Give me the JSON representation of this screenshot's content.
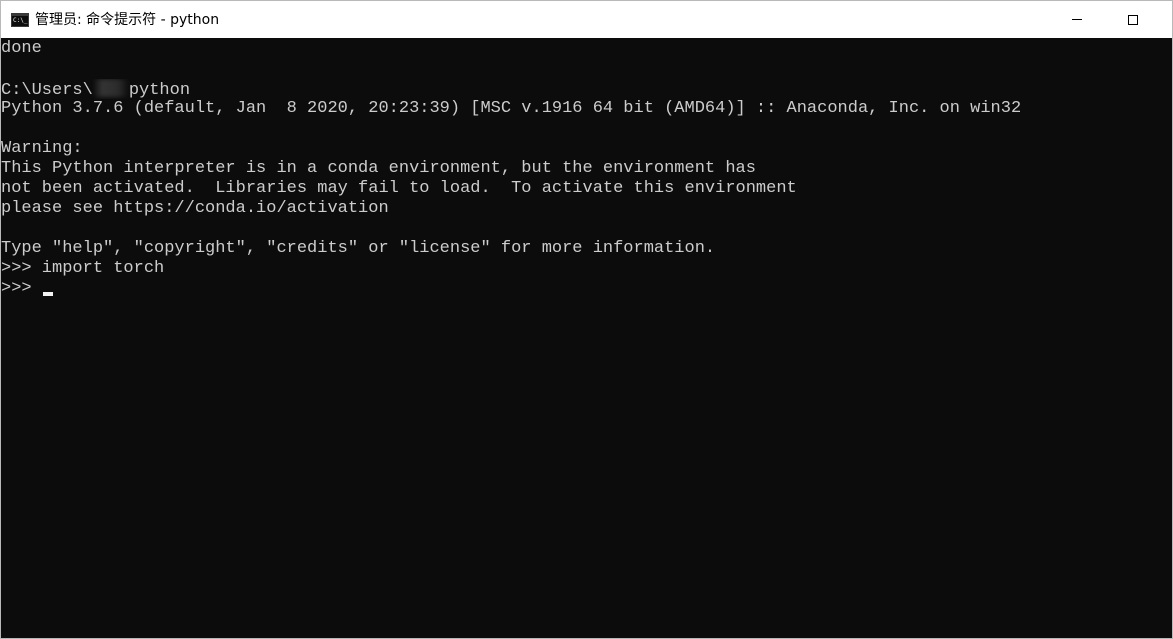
{
  "window": {
    "title": "管理员: 命令提示符 - python",
    "icon": "cmd-icon",
    "icon_text": "C:\\_"
  },
  "console": {
    "lines": [
      "done",
      "",
      "C:\\Users\\",
      "python",
      "Python 3.7.6 (default, Jan  8 2020, 20:23:39) [MSC v.1916 64 bit (AMD64)] :: Anaconda, Inc. on win32",
      "",
      "Warning:",
      "This Python interpreter is in a conda environment, but the environment has",
      "not been activated.  Libraries may fail to load.  To activate this environment",
      "please see https://conda.io/activation",
      "",
      "Type \"help\", \"copyright\", \"credits\" or \"license\" for more information.",
      ">>> import torch",
      ">>> "
    ]
  },
  "colors": {
    "console_background": "#0c0c0c",
    "console_text": "#cccccc",
    "titlebar_background": "#ffffff"
  }
}
